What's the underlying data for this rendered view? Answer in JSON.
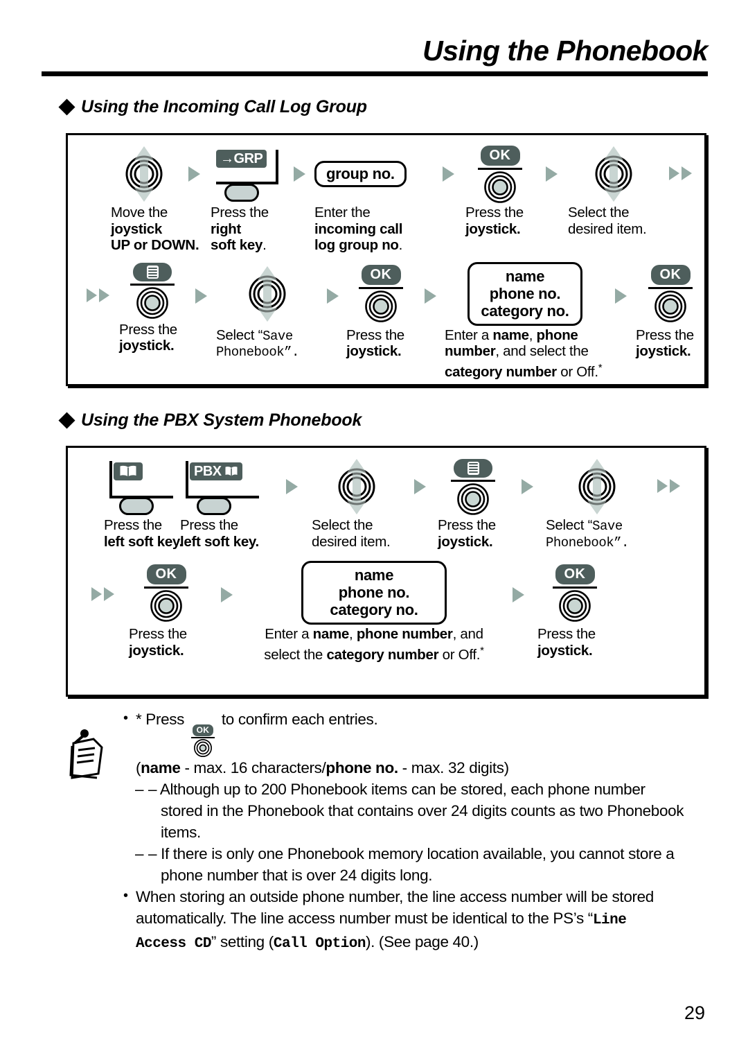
{
  "header": {
    "title": "Using the Phonebook"
  },
  "sections": [
    {
      "heading": "Using the Incoming Call Log Group",
      "rows": [
        {
          "steps": [
            {
              "icon": "joystick-updown-icon",
              "caption_lines": [
                "Move the",
                "joystick",
                "UP or DOWN."
              ]
            },
            {
              "icon": "grp-soft-key-icon",
              "key_label": "→GRP",
              "caption_lines": [
                "Press the",
                "right",
                "soft key."
              ]
            },
            {
              "icon": "data-entry-box",
              "box_lines": [
                "group no."
              ],
              "caption_lines": [
                "Enter the",
                "incoming call",
                "log group no."
              ]
            },
            {
              "icon": "ok-joystick-press-icon",
              "key_label": "OK",
              "caption_lines": [
                "Press the",
                "joystick."
              ]
            },
            {
              "icon": "joystick-updown-icon",
              "caption_lines": [
                "Select the",
                "desired item."
              ]
            }
          ]
        },
        {
          "steps": [
            {
              "icon": "menu-joystick-press-icon",
              "caption_lines": [
                "Press the",
                "joystick."
              ]
            },
            {
              "icon": "joystick-updown-icon",
              "caption_lines": [
                "Select “Save",
                "Phonebook”."
              ]
            },
            {
              "icon": "ok-joystick-press-icon",
              "key_label": "OK",
              "caption_lines": [
                "Press the",
                "joystick."
              ]
            },
            {
              "icon": "data-entry-box",
              "box_lines": [
                "name",
                "phone no.",
                "category no."
              ],
              "caption_lines": [
                "Enter a name, phone",
                "number, and select the",
                "category number or Off.*"
              ]
            },
            {
              "icon": "ok-joystick-press-icon",
              "key_label": "OK",
              "caption_lines": [
                "Press the",
                "joystick."
              ]
            }
          ]
        }
      ]
    },
    {
      "heading": "Using the PBX System Phonebook",
      "rows": [
        {
          "steps": [
            {
              "icon": "phonebook-soft-key-icon",
              "caption_lines": [
                "Press the",
                "left soft key."
              ]
            },
            {
              "icon": "pbx-soft-key-icon",
              "key_label": "PBX",
              "caption_lines": [
                "Press the",
                "left soft key."
              ]
            },
            {
              "icon": "joystick-updown-icon",
              "caption_lines": [
                "Select the",
                "desired item."
              ]
            },
            {
              "icon": "menu-joystick-press-icon",
              "caption_lines": [
                "Press the",
                "joystick."
              ]
            },
            {
              "icon": "joystick-updown-icon",
              "caption_lines": [
                "Select “Save",
                "Phonebook”."
              ]
            }
          ]
        },
        {
          "steps": [
            {
              "icon": "ok-joystick-press-icon",
              "key_label": "OK",
              "caption_lines": [
                "Press the",
                "joystick."
              ]
            },
            {
              "icon": "data-entry-box",
              "box_lines": [
                "name",
                "phone no.",
                "category no."
              ],
              "caption_lines": [
                "Enter a name, phone number, and",
                "select the category number or Off.*"
              ]
            },
            {
              "icon": "ok-joystick-press-icon",
              "key_label": "OK",
              "caption_lines": [
                "Press the",
                "joystick."
              ]
            }
          ]
        }
      ]
    }
  ],
  "note": {
    "icon": "memo-note-icon",
    "ok_key_label": "OK",
    "line1_pre": "* Press",
    "line1_post": "to confirm each entries.",
    "line2_a": "(",
    "line2_b": "name",
    "line2_c": " - max. 16 characters/",
    "line2_d": "phone no.",
    "line2_e": " - max. 32 digits)",
    "line3": "– Although up to 200 Phonebook items can be stored, each phone number",
    "line4": "stored in the Phonebook that contains over 24 digits counts as two Phonebook",
    "line5": "items.",
    "line6": "– If there is only one Phonebook memory location available, you cannot store a",
    "line7": "phone number that is over 24 digits long.",
    "line8": "When storing an outside phone number, the line access number will be stored",
    "line9_a": "automatically. The line access number must be identical to the PS’s “",
    "line9_mono": "Line",
    "line10_mono1": "Access CD",
    "line10_a": "” setting (",
    "line10_mono2": "Call Option",
    "line10_b": "). (See page 40.)"
  },
  "footer": {
    "page_number": "29"
  }
}
